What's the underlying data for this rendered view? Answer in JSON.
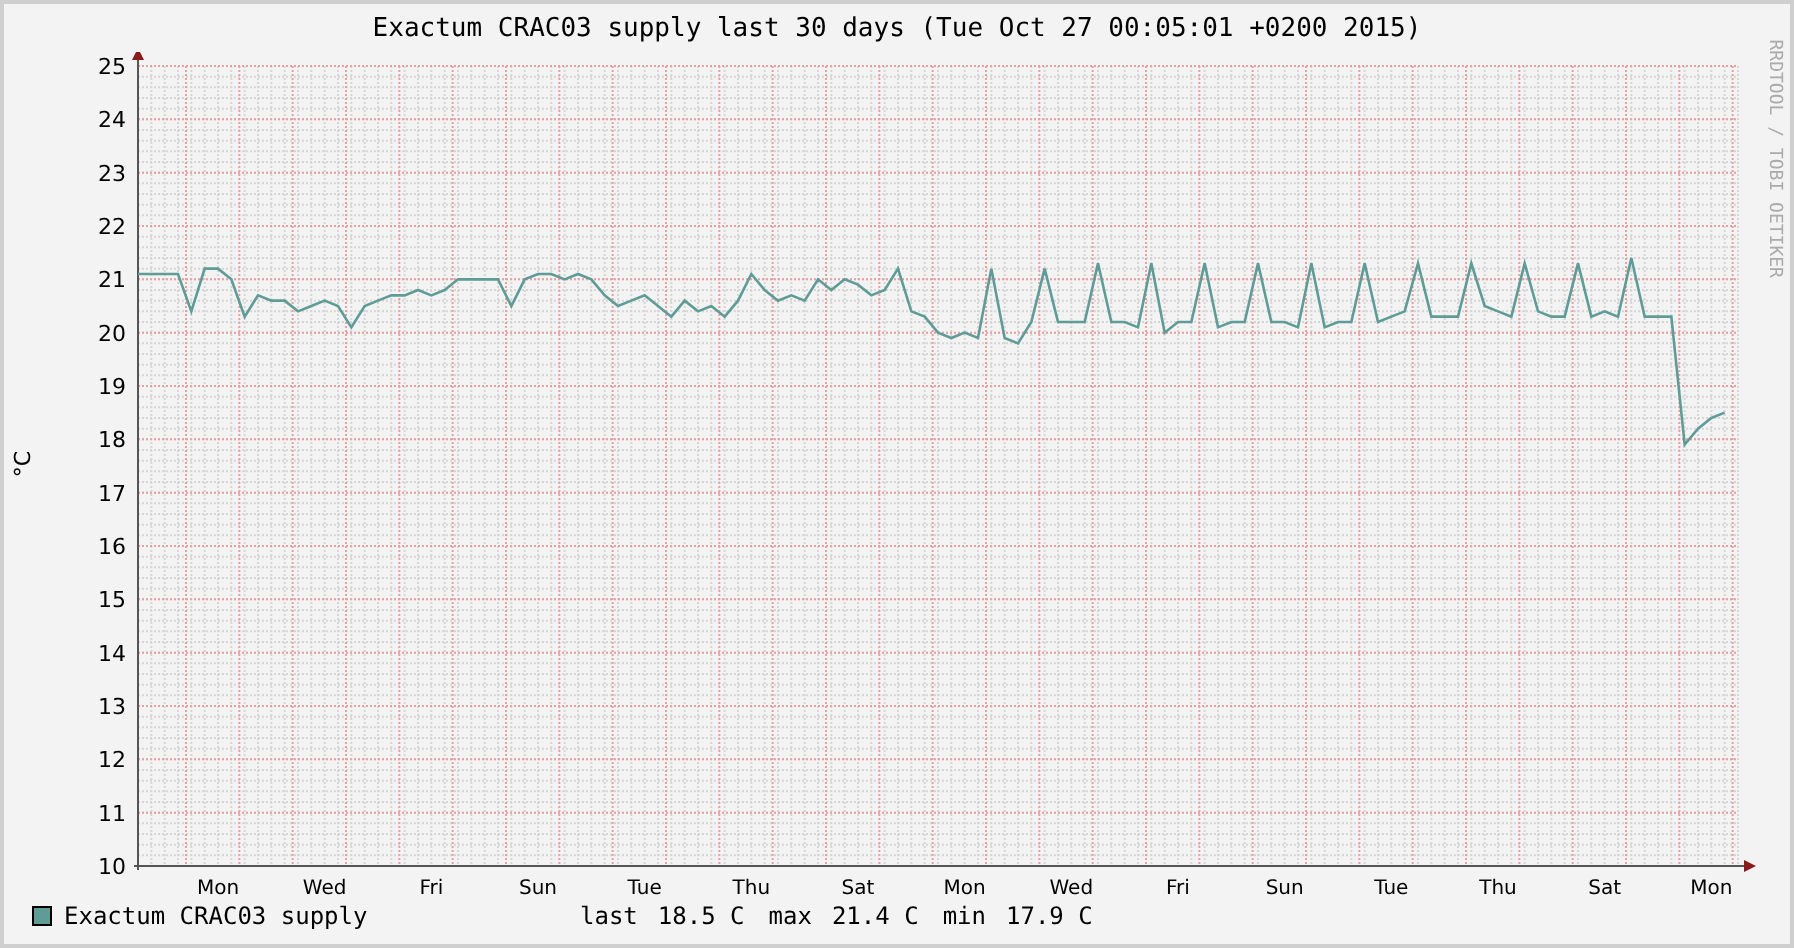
{
  "graph": {
    "title": "Exactum CRAC03 supply last 30 days (Tue Oct 27 00:05:01 +0200 2015)",
    "credit": "RRDTOOL / TOBI OETIKER",
    "chart_data": {
      "type": "line",
      "grid": true,
      "ylabel": "°C",
      "ylim": [
        10,
        25
      ],
      "yticks": [
        10,
        11,
        12,
        13,
        14,
        15,
        16,
        17,
        18,
        19,
        20,
        21,
        22,
        23,
        24,
        25
      ],
      "categories": [
        null,
        null,
        null,
        null,
        null,
        null,
        "Mon",
        null,
        null,
        null,
        null,
        null,
        null,
        null,
        "Wed",
        null,
        null,
        null,
        null,
        null,
        null,
        null,
        "Fri",
        null,
        null,
        null,
        null,
        null,
        null,
        null,
        "Sun",
        null,
        null,
        null,
        null,
        null,
        null,
        null,
        "Tue",
        null,
        null,
        null,
        null,
        null,
        null,
        null,
        "Thu",
        null,
        null,
        null,
        null,
        null,
        null,
        null,
        "Sat",
        null,
        null,
        null,
        null,
        null,
        null,
        null,
        "Mon",
        null,
        null,
        null,
        null,
        null,
        null,
        null,
        "Wed",
        null,
        null,
        null,
        null,
        null,
        null,
        null,
        "Fri",
        null,
        null,
        null,
        null,
        null,
        null,
        null,
        "Sun",
        null,
        null,
        null,
        null,
        null,
        null,
        null,
        "Tue",
        null,
        null,
        null,
        null,
        null,
        null,
        null,
        "Thu",
        null,
        null,
        null,
        null,
        null,
        null,
        null,
        "Sat",
        null,
        null,
        null,
        null,
        null,
        null,
        null,
        "Mon",
        null
      ],
      "series": [
        {
          "name": "Exactum CRAC03 supply",
          "color": "#5f9c97",
          "values": [
            21.1,
            21.1,
            21.1,
            21.1,
            20.4,
            21.2,
            21.2,
            21.0,
            20.3,
            20.7,
            20.6,
            20.6,
            20.4,
            20.5,
            20.6,
            20.5,
            20.1,
            20.5,
            20.6,
            20.7,
            20.7,
            20.8,
            20.7,
            20.8,
            21.0,
            21.0,
            21.0,
            21.0,
            20.5,
            21.0,
            21.1,
            21.1,
            21.0,
            21.1,
            21.0,
            20.7,
            20.5,
            20.6,
            20.7,
            20.5,
            20.3,
            20.6,
            20.4,
            20.5,
            20.3,
            20.6,
            21.1,
            20.8,
            20.6,
            20.7,
            20.6,
            21.0,
            20.8,
            21.0,
            20.9,
            20.7,
            20.8,
            21.2,
            20.4,
            20.3,
            20.0,
            19.9,
            20.0,
            19.9,
            21.2,
            19.9,
            19.8,
            20.2,
            21.2,
            20.2,
            20.2,
            20.2,
            21.3,
            20.2,
            20.2,
            20.1,
            21.3,
            20.0,
            20.2,
            20.2,
            21.3,
            20.1,
            20.2,
            20.2,
            21.3,
            20.2,
            20.2,
            20.1,
            21.3,
            20.1,
            20.2,
            20.2,
            21.3,
            20.2,
            20.3,
            20.4,
            21.3,
            20.3,
            20.3,
            20.3,
            21.3,
            20.5,
            20.4,
            20.3,
            21.3,
            20.4,
            20.3,
            20.3,
            21.3,
            20.3,
            20.4,
            20.3,
            21.4,
            20.3,
            20.3,
            20.3,
            17.9,
            18.2,
            18.4,
            18.5
          ]
        }
      ]
    }
  },
  "legend": {
    "color": "#5f9c97",
    "stats": [
      {
        "label": "last",
        "value": "18.5 C"
      },
      {
        "label": "max",
        "value": "21.4 C"
      },
      {
        "label": "min",
        "value": "17.9 C"
      }
    ]
  }
}
